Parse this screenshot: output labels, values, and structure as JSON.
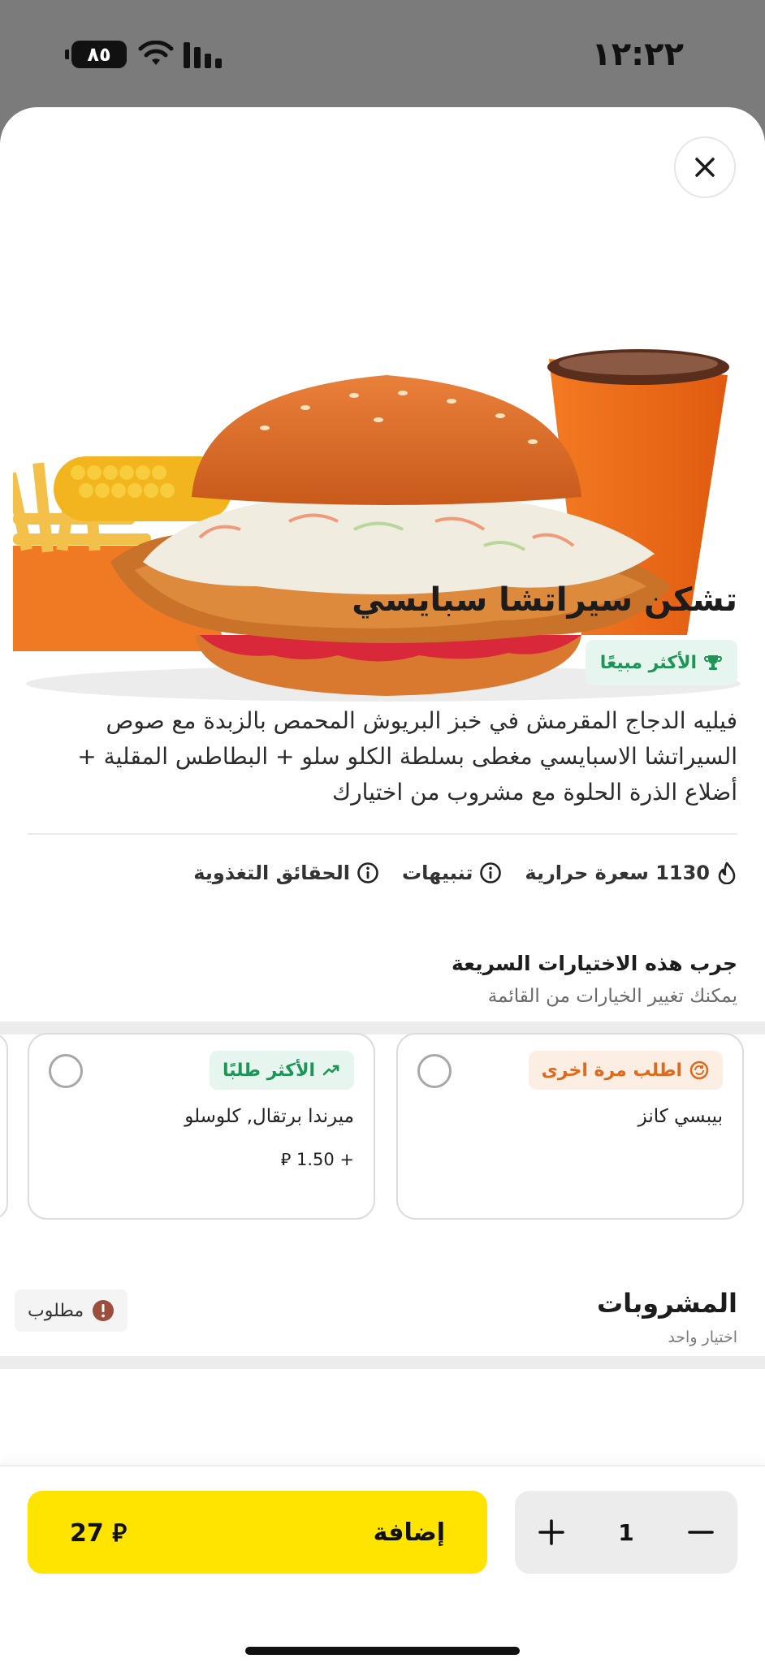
{
  "status_bar": {
    "time": "١٢:٢٢",
    "battery": "٨٥"
  },
  "product": {
    "title": "تشكن سيراتشا سبايسي",
    "badge": "الأكثر مبيعًا",
    "description": "فيليه الدجاج المقرمش في خبز البريوش المحمص بالزبدة مع صوص السيراتشا الاسبايسي مغطى بسلطة الكلو سلو + البطاطس المقلية + أضلاع الذرة الحلوة مع مشروب من اختيارك",
    "calories": "1130 سعرة حرارية",
    "alerts": "تنبيهات",
    "nutrition": "الحقائق التغذوية"
  },
  "quick_picks": {
    "title": "جرب هذه الاختيارات السريعة",
    "subtitle": "يمكنك تغيير الخيارات من القائمة",
    "cards": [
      {
        "badge": "اطلب مرة اخرى",
        "name": "بيبسي كانز",
        "price": ""
      },
      {
        "badge": "الأكثر طلبًا",
        "name": "ميرندا برتقال, كلوسلو",
        "price": "+ 1.50 ⃁"
      }
    ]
  },
  "drinks": {
    "title": "المشروبات",
    "subtitle": "اختيار واحد",
    "required": "مطلوب"
  },
  "footer": {
    "add_label": "إضافة",
    "price": "27 ⃁",
    "quantity": "1"
  },
  "colors": {
    "accent": "#ffe400",
    "best_seller_bg": "#e6f5ee",
    "best_seller_fg": "#1d9557",
    "reorder_bg": "#fdeee3",
    "reorder_fg": "#e06a1b"
  },
  "icons": [
    "close-icon",
    "trophy-icon",
    "flame-icon",
    "info-icon",
    "reorder-icon",
    "trending-icon",
    "alert-icon",
    "plus-icon",
    "minus-icon"
  ]
}
